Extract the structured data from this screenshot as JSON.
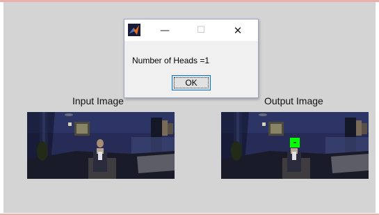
{
  "figure": {
    "input_title": "Input Image",
    "output_title": "Output Image"
  },
  "dialog": {
    "app_icon": "matlab-icon",
    "minimize_glyph": "—",
    "maximize_glyph": "☐",
    "close_glyph": "✕",
    "message": "Number of Heads =1",
    "ok_label": "OK"
  },
  "detection": {
    "box_color": "#00ff00",
    "count": 1
  }
}
